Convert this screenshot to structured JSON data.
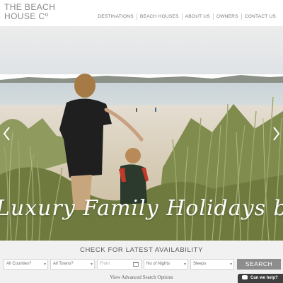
{
  "logo": {
    "line1": "THE BEACH",
    "line2": "HOUSE Cº"
  },
  "nav": {
    "items": [
      "DESTINATIONS",
      "BEACH HOUSES",
      "ABOUT US",
      "OWNERS",
      "CONTACT US"
    ]
  },
  "hero": {
    "tagline": "Luxury Family Holidays by the Sea",
    "arrow_left_icon": "chevron-left-icon",
    "arrow_right_icon": "chevron-right-icon"
  },
  "availability": {
    "title": "CHECK FOR LATEST AVAILABILITY",
    "counties": "All Counties?",
    "towns": "All Towns?",
    "from": "From",
    "nights": "No of Nights",
    "sleeps": "Sleeps",
    "search_label": "SEARCH",
    "advanced": "View Advanced Search Options"
  },
  "help": {
    "label": "Can we help?"
  },
  "colors": {
    "accent_button": "#8d8d8d",
    "help_bg": "#3f3f3f",
    "avail_bg": "#f1f1f1"
  }
}
